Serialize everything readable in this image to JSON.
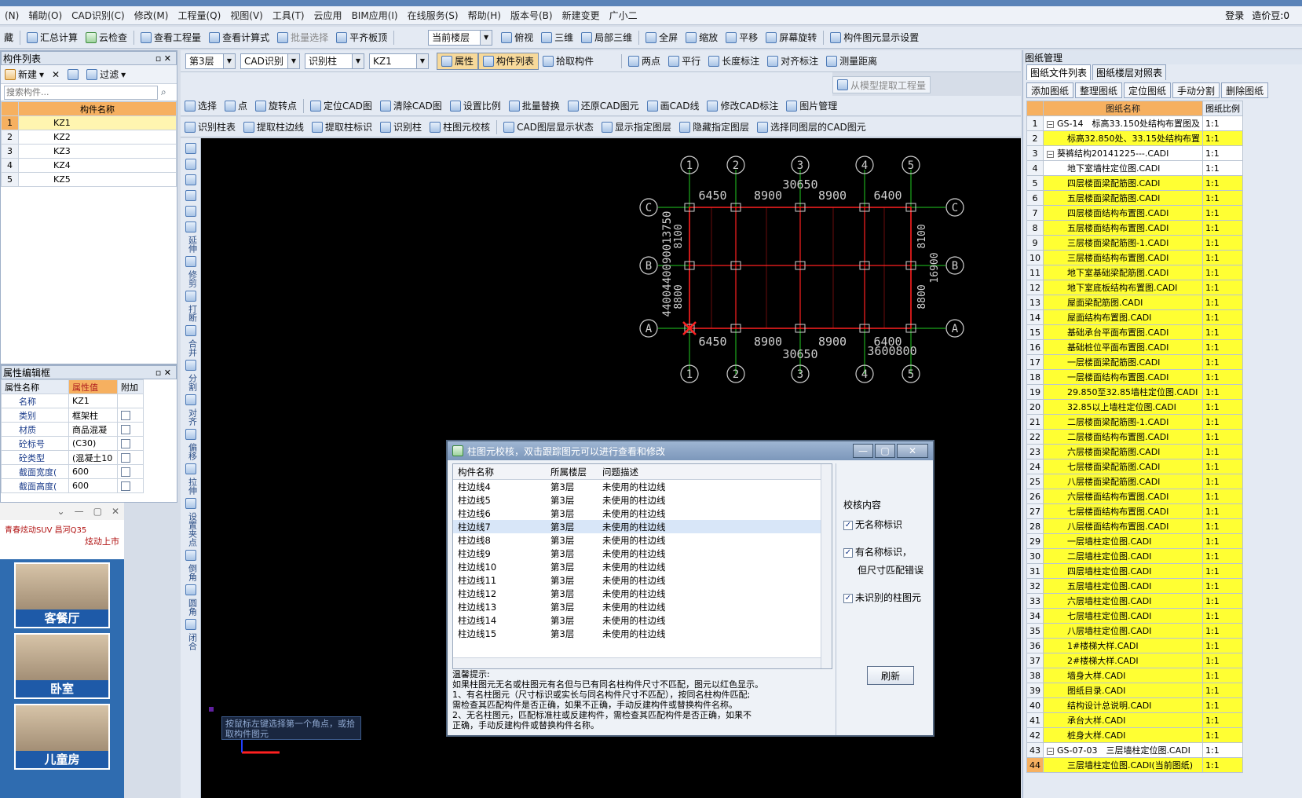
{
  "menu": [
    "(N)",
    "辅助(O)",
    "CAD识别(C)",
    "修改(M)",
    "工程量(Q)",
    "视图(V)",
    "工具(T)",
    "云应用",
    "BIM应用(I)",
    "在线服务(S)",
    "帮助(H)",
    "版本号(B)",
    "新建变更",
    "广小二"
  ],
  "menu_right": {
    "login": "登录",
    "user": "造价豆:0"
  },
  "toolbar1": [
    "藏",
    "汇总计算",
    "云检查",
    "查看工程量",
    "查看计算式",
    "批量选择",
    "平齐板顶",
    "当前楼层",
    "俯视",
    "三维",
    "局部三维",
    "全屏",
    "缩放",
    "平移",
    "屏幕旋转",
    "构件图元显示设置"
  ],
  "left_panel": {
    "title": "构件列表",
    "buttons": [
      "新建",
      "过滤"
    ],
    "search_placeholder": "搜索构件...",
    "header": "构件名称",
    "items": [
      "KZ1",
      "KZ2",
      "KZ3",
      "KZ4",
      "KZ5"
    ]
  },
  "prop_panel": {
    "title": "属性编辑框",
    "headers": [
      "属性名称",
      "属性值",
      "附加"
    ],
    "rows": [
      {
        "name": "名称",
        "value": "KZ1"
      },
      {
        "name": "类别",
        "value": "框架柱"
      },
      {
        "name": "材质",
        "value": "商品混凝"
      },
      {
        "name": "砼标号",
        "value": "(C30)"
      },
      {
        "name": "砼类型",
        "value": "(混凝土10"
      },
      {
        "name": "截面宽度(",
        "value": "600"
      },
      {
        "name": "截面高度(",
        "value": "600"
      }
    ]
  },
  "toolbar2": {
    "floor": "第3层",
    "mode": "CAD识别",
    "type": "识别柱",
    "comp": "KZ1",
    "buttons": [
      "属性",
      "构件列表",
      "拾取构件",
      "两点",
      "平行",
      "长度标注",
      "对齐标注",
      "测量距离",
      "从模型提取工程量"
    ]
  },
  "toolbar3": [
    "选择",
    "点",
    "旋转点",
    "定位CAD图",
    "清除CAD图",
    "设置比例",
    "批量替换",
    "还原CAD图元",
    "画CAD线",
    "修改CAD标注",
    "图片管理"
  ],
  "toolbar4": [
    "识别柱表",
    "提取柱边线",
    "提取柱标识",
    "识别柱",
    "柱图元校核",
    "CAD图层显示状态",
    "显示指定图层",
    "隐藏指定图层",
    "选择同图层的CAD图元"
  ],
  "vtools": [
    "延伸",
    "修剪",
    "打断",
    "合并",
    "分割",
    "对齐",
    "偏移",
    "拉伸",
    "设置夹点",
    "倒角",
    "圆角",
    "闭合"
  ],
  "cad": {
    "axis_numbers": [
      "1",
      "2",
      "3",
      "4",
      "5"
    ],
    "axis_letters": [
      "C",
      "B",
      "A"
    ],
    "top_dims": [
      "6450",
      "8900",
      "8900",
      "6400"
    ],
    "total": "30650",
    "bottom_dims": [
      "6450",
      "8900",
      "8900",
      "6400"
    ],
    "bottom_total": "30650",
    "bottom_extra": "3600800",
    "left_dims": [
      "8100",
      "8800"
    ],
    "left_vertical": "4400440090013750",
    "right_dims": [
      "8100",
      "8800"
    ],
    "right_total": "16900",
    "hint": "按鼠标左键选择第一个角点，或拾取构件图元"
  },
  "dialog": {
    "title": "柱图元校核，双击跟踪图元可以进行查看和修改",
    "columns": [
      "构件名称",
      "所属楼层",
      "问题描述"
    ],
    "rows": [
      {
        "name": "柱边线4",
        "floor": "第3层",
        "desc": "未使用的柱边线"
      },
      {
        "name": "柱边线5",
        "floor": "第3层",
        "desc": "未使用的柱边线"
      },
      {
        "name": "柱边线6",
        "floor": "第3层",
        "desc": "未使用的柱边线"
      },
      {
        "name": "柱边线7",
        "floor": "第3层",
        "desc": "未使用的柱边线"
      },
      {
        "name": "柱边线8",
        "floor": "第3层",
        "desc": "未使用的柱边线"
      },
      {
        "name": "柱边线9",
        "floor": "第3层",
        "desc": "未使用的柱边线"
      },
      {
        "name": "柱边线10",
        "floor": "第3层",
        "desc": "未使用的柱边线"
      },
      {
        "name": "柱边线11",
        "floor": "第3层",
        "desc": "未使用的柱边线"
      },
      {
        "name": "柱边线12",
        "floor": "第3层",
        "desc": "未使用的柱边线"
      },
      {
        "name": "柱边线13",
        "floor": "第3层",
        "desc": "未使用的柱边线"
      },
      {
        "name": "柱边线14",
        "floor": "第3层",
        "desc": "未使用的柱边线"
      },
      {
        "name": "柱边线15",
        "floor": "第3层",
        "desc": "未使用的柱边线"
      }
    ],
    "check_title": "校核内容",
    "checks": [
      "无名称标识",
      "有名称标识，",
      "未识别的柱图元"
    ],
    "check_sub": "但尺寸匹配错误",
    "refresh": "刷新",
    "tips_title": "温馨提示:",
    "tips": [
      "如果柱图元无名或柱图元有名但与已有同名柱构件尺寸不匹配，图元以红色显示。",
      "1、有名柱图元（尺寸标识或实长与同名构件尺寸不匹配），按同名柱构件匹配;",
      "需检查其匹配构件是否正确，如果不正确，手动反建构件或替换构件名称。",
      "2、无名柱图元，匹配标准柱或反建构件，需检查其匹配构件是否正确，如果不",
      "正确，手动反建构件或替换构件名称。"
    ]
  },
  "right_panel": {
    "title": "图纸管理",
    "tabs": [
      "图纸文件列表",
      "图纸楼层对照表"
    ],
    "buttons": [
      "添加图纸",
      "整理图纸",
      "定位图纸",
      "手动分割",
      "删除图纸"
    ],
    "headers": [
      "图纸名称",
      "图纸比例"
    ],
    "rows": [
      {
        "n": "1",
        "name": "GS-14　标高33.150处结构布置图及",
        "s": "1:1",
        "y": false,
        "grp": true
      },
      {
        "n": "2",
        "name": "标高32.850处、33.15处结构布置",
        "s": "1:1",
        "y": true
      },
      {
        "n": "3",
        "name": "葵裤结构20141225---.CADI",
        "s": "1:1",
        "y": false,
        "grp": true
      },
      {
        "n": "4",
        "name": "地下室墙柱定位图.CADI",
        "s": "1:1",
        "y": false
      },
      {
        "n": "5",
        "name": "四层楼面梁配筋图.CADI",
        "s": "1:1",
        "y": true
      },
      {
        "n": "6",
        "name": "五层楼面梁配筋图.CADI",
        "s": "1:1",
        "y": true
      },
      {
        "n": "7",
        "name": "四层楼面结构布置图.CADI",
        "s": "1:1",
        "y": true
      },
      {
        "n": "8",
        "name": "五层楼面结构布置图.CADI",
        "s": "1:1",
        "y": true
      },
      {
        "n": "9",
        "name": "三层楼面梁配筋图-1.CADI",
        "s": "1:1",
        "y": true
      },
      {
        "n": "10",
        "name": "三层楼面结构布置图.CADI",
        "s": "1:1",
        "y": true
      },
      {
        "n": "11",
        "name": "地下室基础梁配筋图.CADI",
        "s": "1:1",
        "y": true
      },
      {
        "n": "12",
        "name": "地下室底板结构布置图.CADI",
        "s": "1:1",
        "y": true
      },
      {
        "n": "13",
        "name": "屋面梁配筋图.CADI",
        "s": "1:1",
        "y": true
      },
      {
        "n": "14",
        "name": "屋面结构布置图.CADI",
        "s": "1:1",
        "y": true
      },
      {
        "n": "15",
        "name": "基础承台平面布置图.CADI",
        "s": "1:1",
        "y": true
      },
      {
        "n": "16",
        "name": "基础桩位平面布置图.CADI",
        "s": "1:1",
        "y": true
      },
      {
        "n": "17",
        "name": "一层楼面梁配筋图.CADI",
        "s": "1:1",
        "y": true
      },
      {
        "n": "18",
        "name": "一层楼面结构布置图.CADI",
        "s": "1:1",
        "y": true
      },
      {
        "n": "19",
        "name": "29.850至32.85墙柱定位图.CADI",
        "s": "1:1",
        "y": true
      },
      {
        "n": "20",
        "name": "32.85以上墙柱定位图.CADI",
        "s": "1:1",
        "y": true
      },
      {
        "n": "21",
        "name": "二层楼面梁配筋图-1.CADI",
        "s": "1:1",
        "y": true
      },
      {
        "n": "22",
        "name": "二层楼面结构布置图.CADI",
        "s": "1:1",
        "y": true
      },
      {
        "n": "23",
        "name": "六层楼面梁配筋图.CADI",
        "s": "1:1",
        "y": true
      },
      {
        "n": "24",
        "name": "七层楼面梁配筋图.CADI",
        "s": "1:1",
        "y": true
      },
      {
        "n": "25",
        "name": "八层楼面梁配筋图.CADI",
        "s": "1:1",
        "y": true
      },
      {
        "n": "26",
        "name": "六层楼面结构布置图.CADI",
        "s": "1:1",
        "y": true
      },
      {
        "n": "27",
        "name": "七层楼面结构布置图.CADI",
        "s": "1:1",
        "y": true
      },
      {
        "n": "28",
        "name": "八层楼面结构布置图.CADI",
        "s": "1:1",
        "y": true
      },
      {
        "n": "29",
        "name": "一层墙柱定位图.CADI",
        "s": "1:1",
        "y": true
      },
      {
        "n": "30",
        "name": "二层墙柱定位图.CADI",
        "s": "1:1",
        "y": true
      },
      {
        "n": "31",
        "name": "四层墙柱定位图.CADI",
        "s": "1:1",
        "y": true
      },
      {
        "n": "32",
        "name": "五层墙柱定位图.CADI",
        "s": "1:1",
        "y": true
      },
      {
        "n": "33",
        "name": "六层墙柱定位图.CADI",
        "s": "1:1",
        "y": true
      },
      {
        "n": "34",
        "name": "七层墙柱定位图.CADI",
        "s": "1:1",
        "y": true
      },
      {
        "n": "35",
        "name": "八层墙柱定位图.CADI",
        "s": "1:1",
        "y": true
      },
      {
        "n": "36",
        "name": "1#楼梯大样.CADI",
        "s": "1:1",
        "y": true
      },
      {
        "n": "37",
        "name": "2#楼梯大样.CADI",
        "s": "1:1",
        "y": true
      },
      {
        "n": "38",
        "name": "墙身大样.CADI",
        "s": "1:1",
        "y": true
      },
      {
        "n": "39",
        "name": "图纸目录.CADI",
        "s": "1:1",
        "y": true
      },
      {
        "n": "40",
        "name": "结构设计总说明.CADI",
        "s": "1:1",
        "y": true
      },
      {
        "n": "41",
        "name": "承台大样.CADI",
        "s": "1:1",
        "y": true
      },
      {
        "n": "42",
        "name": "桩身大样.CADI",
        "s": "1:1",
        "y": true
      },
      {
        "n": "43",
        "name": "GS-07-03　三层墙柱定位图.CADI",
        "s": "1:1",
        "y": false,
        "grp": true
      },
      {
        "n": "44",
        "name": "三层墙柱定位图.CADI(当前图纸)",
        "s": "1:1",
        "y": true,
        "cur": true
      }
    ]
  },
  "ad": {
    "banner": "青春炫动SUV 昌河Q35",
    "banner_sub": "炫动上市",
    "items": [
      "客餐厅",
      "卧室",
      "儿童房"
    ]
  },
  "colors": {
    "yellow": "#ffff33",
    "orange_header": "#f6b060",
    "canvas": "#000000",
    "cad_green": "#22cc22",
    "cad_red": "#ff2020"
  }
}
